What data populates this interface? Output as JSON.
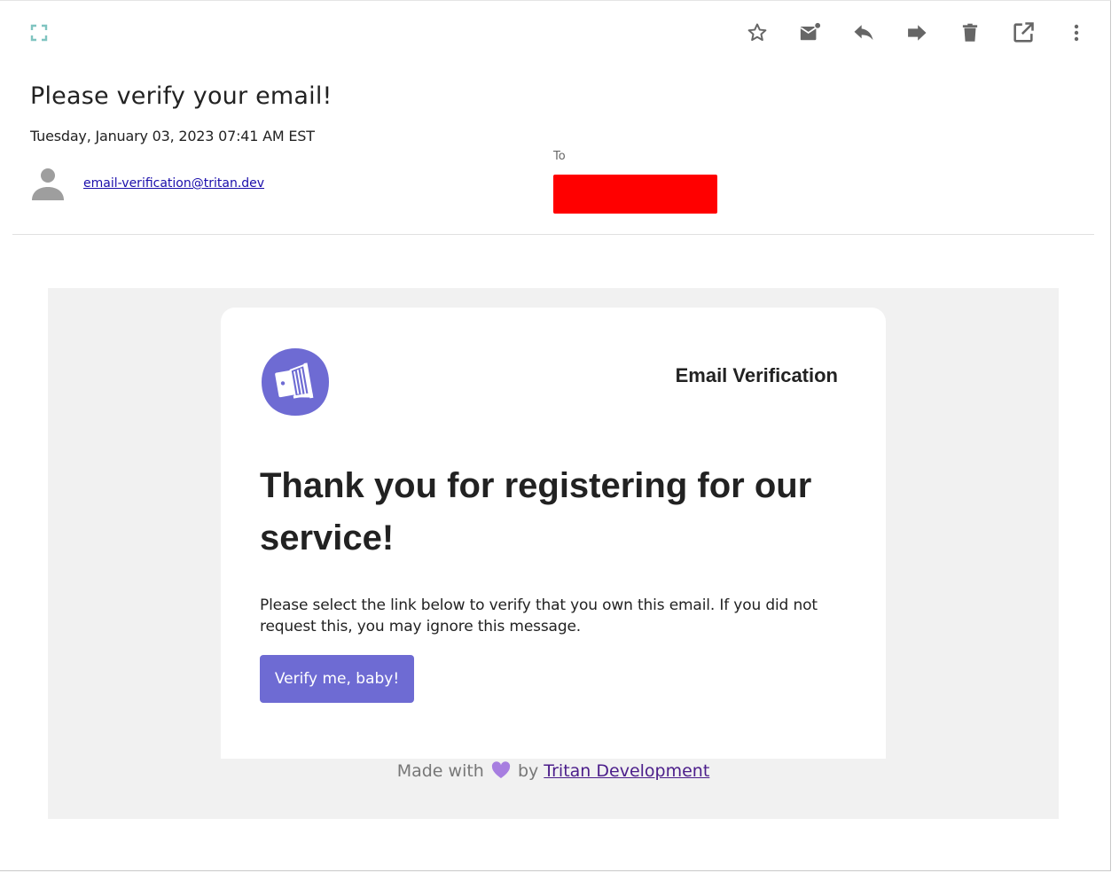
{
  "toolbar": {
    "icons": [
      "star-icon",
      "mark-unread-icon",
      "reply-icon",
      "forward-icon",
      "delete-icon",
      "open-in-new-icon",
      "more-vert-icon"
    ]
  },
  "email": {
    "subject": "Please verify your email!",
    "date": "Tuesday, January 03, 2023 07:41 AM EST",
    "from": "email-verification@tritan.dev",
    "to_label": "To"
  },
  "content": {
    "card_label": "Email Verification",
    "headline": "Thank you for registering for our service!",
    "body": "Please select the link below to verify that you own this email. If you did not request this, you may ignore this message.",
    "button_label": "Verify me, baby!",
    "footer_prefix": "Made with",
    "footer_by": "by",
    "footer_link": "Tritan Development"
  },
  "colors": {
    "accent": "#6e6bd3",
    "redaction": "#ff0000",
    "heart": "#a77ee0",
    "link": "#1a0dab"
  }
}
